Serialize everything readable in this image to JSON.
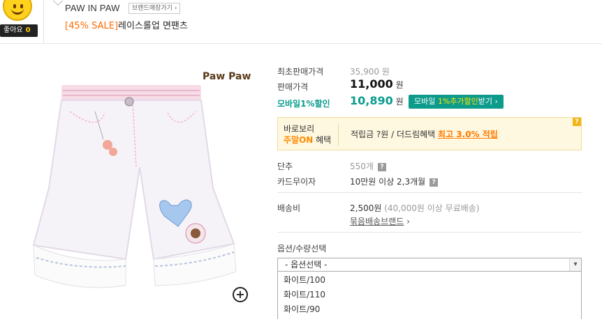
{
  "header": {
    "like_label": "좋아요",
    "like_count": "0",
    "brand_name": "PAW IN PAW",
    "brand_shop_button": "브랜드매장가기 ›",
    "sale_tag": "[45% SALE]",
    "product_name": "레이스롤업 면팬츠"
  },
  "image": {
    "logo_text": "Paw Paw",
    "zoom_icon": "plus-circle-icon"
  },
  "pricing": {
    "original_label": "최초판매가격",
    "original_value": "35,900 원",
    "sale_label": "판매가격",
    "sale_value": "11,000",
    "sale_unit": "원",
    "mobile_label": "모바일1%할인",
    "mobile_value": "10,890",
    "mobile_unit": "원",
    "mobile_button_pre": "모바일 ",
    "mobile_button_hl": "1%추가할인",
    "mobile_button_post": "받기 ›"
  },
  "benefit": {
    "line1": "바로보리",
    "line2_on": "주말ON",
    "line2_rest": " 혜택",
    "points_text": "적립금 ?원 / 더드림혜택 ",
    "best_text": "최고 3.0% 적립",
    "help_icon": "?"
  },
  "details": {
    "shortage_label": "단추",
    "shortage_value": "550개",
    "card_label": "카드무이자",
    "card_value": "10만원 이상 2,3개월",
    "shipping_label": "배송비",
    "shipping_value": "2,500원",
    "shipping_note": "(40,000원 이상 무료배송)",
    "bundle_link": "묶음배송브랜드",
    "bundle_arrow": " ›"
  },
  "options": {
    "section_label": "옵션/수량선택",
    "placeholder": "- 옵션선택 -",
    "items": [
      "화이트/100",
      "화이트/110",
      "화이트/90"
    ]
  },
  "colors": {
    "sale_orange": "#ff6a00",
    "mobile_teal": "#0a9c8e",
    "benefit_bg": "#fff8e0"
  }
}
